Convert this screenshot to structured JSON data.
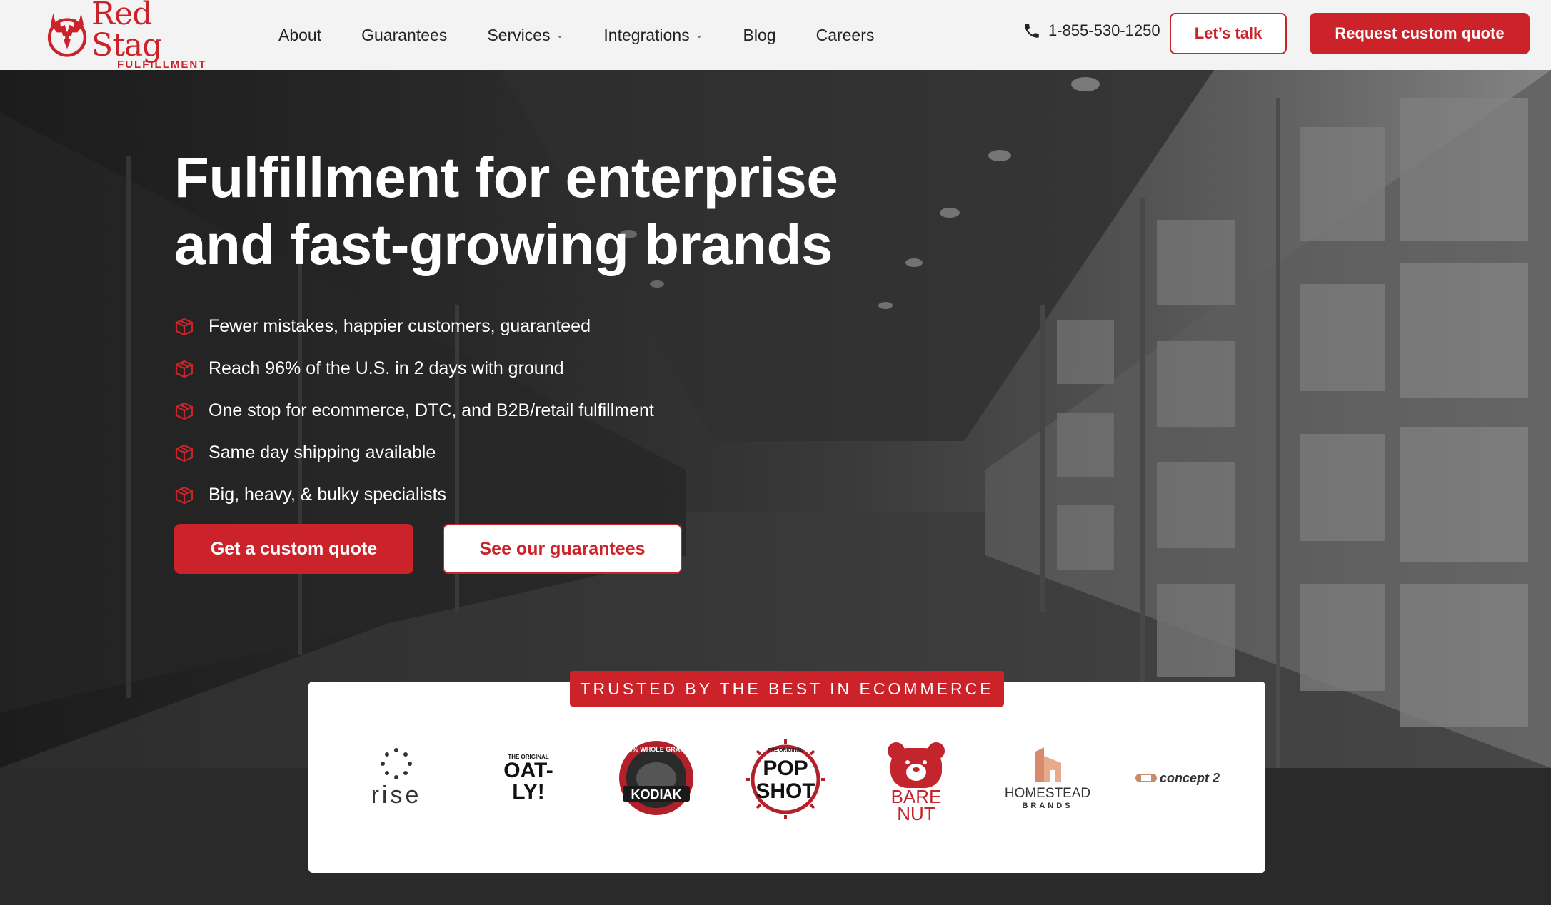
{
  "header": {
    "logo_name": "Red Stag",
    "logo_sub": "FULFILLMENT",
    "nav": [
      {
        "label": "About",
        "has_dropdown": false
      },
      {
        "label": "Guarantees",
        "has_dropdown": false
      },
      {
        "label": "Services",
        "has_dropdown": true
      },
      {
        "label": "Integrations",
        "has_dropdown": true
      },
      {
        "label": "Blog",
        "has_dropdown": false
      },
      {
        "label": "Careers",
        "has_dropdown": false
      }
    ],
    "phone": "1-855-530-1250",
    "talk_label": "Let’s talk",
    "quote_label": "Request custom quote"
  },
  "hero": {
    "headline_line1": "Fulfillment for enterprise",
    "headline_line2": "and fast-growing brands",
    "features": [
      "Fewer mistakes, happier customers, guaranteed",
      "Reach 96% of the U.S. in 2 days with ground",
      "One stop for ecommerce, DTC, and B2B/retail fulfillment",
      "Same day shipping available",
      "Big, heavy, & bulky specialists"
    ],
    "cta_primary": "Get a custom quote",
    "cta_secondary": "See our guarantees"
  },
  "trusted": {
    "tag": "TRUSTED BY THE BEST IN ECOMMERCE",
    "brands": {
      "rise": "rise",
      "oatly_small": "THE ORIGINAL",
      "oatly": "OAT-LY!",
      "kodiak_ring": "100% WHOLE GRAINS",
      "kodiak": "KODIAK",
      "popshot_top": "THE ORIGINAL",
      "popshot_1": "POP",
      "popshot_2": "SHOT",
      "barenut_1": "BARE",
      "barenut_2": "NUT",
      "homestead_1": "HOMESTEAD",
      "homestead_2": "BRANDS",
      "concept2": "concept 2"
    }
  },
  "colors": {
    "brand_red": "#cc2229",
    "header_bg": "#f3f3f4",
    "dark_bg": "#2a2a2a"
  }
}
